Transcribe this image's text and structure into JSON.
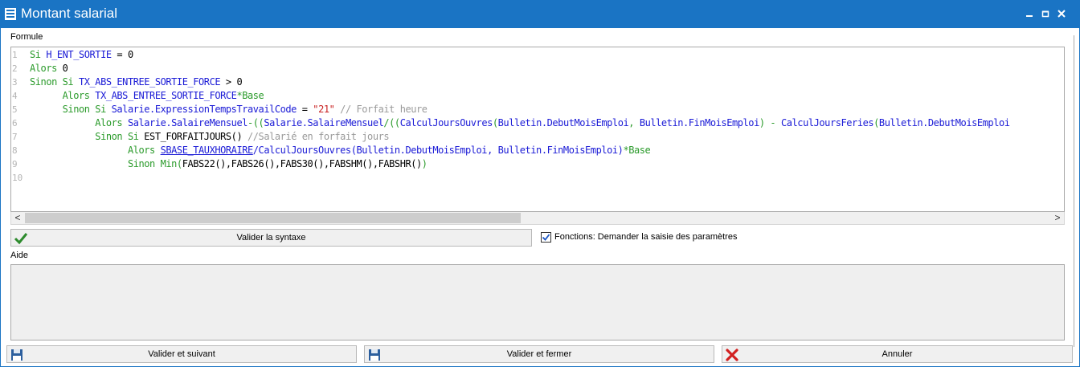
{
  "window": {
    "title": "Montant salarial",
    "controls": [
      "minimize-icon",
      "maximize-icon",
      "close-icon"
    ]
  },
  "labels": {
    "formule": "Formule",
    "aide": "Aide"
  },
  "code_lines": [
    {
      "n": "1",
      "tokens": [
        [
          "kw",
          "Si "
        ],
        [
          "id",
          "H_ENT_SORTIE"
        ],
        [
          "num",
          " = 0"
        ]
      ]
    },
    {
      "n": "2",
      "tokens": [
        [
          "kw",
          "Alors "
        ],
        [
          "num",
          "0"
        ]
      ]
    },
    {
      "n": "3",
      "tokens": [
        [
          "kw",
          "Sinon Si "
        ],
        [
          "id",
          "TX_ABS_ENTREE_SORTIE_FORCE"
        ],
        [
          "num",
          " > 0"
        ]
      ]
    },
    {
      "n": "4",
      "tokens": [
        [
          "kw",
          "      Alors "
        ],
        [
          "id",
          "TX_ABS_ENTREE_SORTIE_FORCE"
        ],
        [
          "kw",
          "*Base"
        ]
      ]
    },
    {
      "n": "5",
      "tokens": [
        [
          "kw",
          "      Sinon Si "
        ],
        [
          "id",
          "Salarie.ExpressionTempsTravailCode"
        ],
        [
          "num",
          " = "
        ],
        [
          "str",
          "\"21\""
        ],
        [
          "cm",
          " // Forfait heure"
        ]
      ]
    },
    {
      "n": "6",
      "tokens": [
        [
          "kw",
          "            Alors "
        ],
        [
          "id",
          "Salarie.SalaireMensuel"
        ],
        [
          "kw",
          "-(("
        ],
        [
          "id",
          "Salarie.SalaireMensuel"
        ],
        [
          "kw",
          "/(("
        ],
        [
          "id",
          "CalculJoursOuvres"
        ],
        [
          "kw",
          "("
        ],
        [
          "id",
          "Bulletin.DebutMoisEmploi"
        ],
        [
          "kw",
          ", "
        ],
        [
          "id",
          "Bulletin.FinMoisEmploi"
        ],
        [
          "kw",
          ") - "
        ],
        [
          "id",
          "CalculJoursFeries"
        ],
        [
          "kw",
          "("
        ],
        [
          "id",
          "Bulletin.DebutMoisEmploi"
        ]
      ]
    },
    {
      "n": "7",
      "tokens": [
        [
          "kw",
          "            Sinon Si "
        ],
        [
          "num",
          "EST_FORFAITJOURS() "
        ],
        [
          "cm",
          "//Salarié en forfait jours"
        ]
      ]
    },
    {
      "n": "8",
      "tokens": [
        [
          "kw",
          "                  Alors "
        ],
        [
          "ul",
          "SBASE_TAUXHORAIRE"
        ],
        [
          "id",
          "/CalculJoursOuvres(Bulletin.DebutMoisEmploi, Bulletin.FinMoisEmploi)"
        ],
        [
          "kw",
          "*Base"
        ]
      ]
    },
    {
      "n": "9",
      "tokens": [
        [
          "kw",
          "                  Sinon "
        ],
        [
          "kw",
          "Min("
        ],
        [
          "num",
          "FABS22(),FABS26(),FABS30(),FABSHM(),FABSHR()"
        ],
        [
          "kw",
          ")"
        ]
      ]
    },
    {
      "n": "10",
      "tokens": []
    }
  ],
  "buttons": {
    "valider_syntaxe": "Valider la syntaxe",
    "valider_suivant": "Valider et suivant",
    "valider_fermer": "Valider et fermer",
    "annuler": "Annuler"
  },
  "checkbox": {
    "label": "Fonctions: Demander la saisie des paramètres",
    "checked": true
  },
  "scrollbar": {
    "left_arrow": "<",
    "right_arrow": ">"
  },
  "colors": {
    "titlebar": "#1a74c4",
    "keyword": "#2a9a2a",
    "identifier": "#1a1ad6",
    "string": "#c81e1e",
    "comment": "#9a9a9a"
  }
}
